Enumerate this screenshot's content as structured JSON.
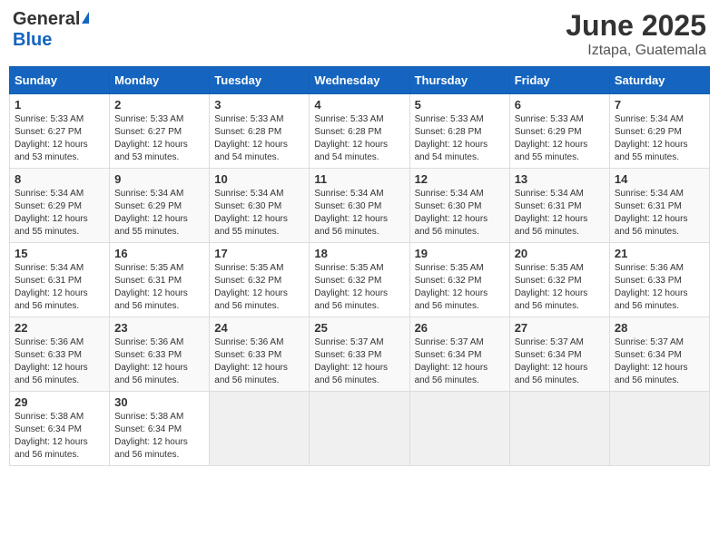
{
  "logo": {
    "general": "General",
    "blue": "Blue"
  },
  "header": {
    "month_year": "June 2025",
    "location": "Iztapa, Guatemala"
  },
  "weekdays": [
    "Sunday",
    "Monday",
    "Tuesday",
    "Wednesday",
    "Thursday",
    "Friday",
    "Saturday"
  ],
  "weeks": [
    [
      {
        "day": "1",
        "sunrise": "5:33 AM",
        "sunset": "6:27 PM",
        "daylight": "12 hours and 53 minutes."
      },
      {
        "day": "2",
        "sunrise": "5:33 AM",
        "sunset": "6:27 PM",
        "daylight": "12 hours and 53 minutes."
      },
      {
        "day": "3",
        "sunrise": "5:33 AM",
        "sunset": "6:28 PM",
        "daylight": "12 hours and 54 minutes."
      },
      {
        "day": "4",
        "sunrise": "5:33 AM",
        "sunset": "6:28 PM",
        "daylight": "12 hours and 54 minutes."
      },
      {
        "day": "5",
        "sunrise": "5:33 AM",
        "sunset": "6:28 PM",
        "daylight": "12 hours and 54 minutes."
      },
      {
        "day": "6",
        "sunrise": "5:33 AM",
        "sunset": "6:29 PM",
        "daylight": "12 hours and 55 minutes."
      },
      {
        "day": "7",
        "sunrise": "5:34 AM",
        "sunset": "6:29 PM",
        "daylight": "12 hours and 55 minutes."
      }
    ],
    [
      {
        "day": "8",
        "sunrise": "5:34 AM",
        "sunset": "6:29 PM",
        "daylight": "12 hours and 55 minutes."
      },
      {
        "day": "9",
        "sunrise": "5:34 AM",
        "sunset": "6:29 PM",
        "daylight": "12 hours and 55 minutes."
      },
      {
        "day": "10",
        "sunrise": "5:34 AM",
        "sunset": "6:30 PM",
        "daylight": "12 hours and 55 minutes."
      },
      {
        "day": "11",
        "sunrise": "5:34 AM",
        "sunset": "6:30 PM",
        "daylight": "12 hours and 56 minutes."
      },
      {
        "day": "12",
        "sunrise": "5:34 AM",
        "sunset": "6:30 PM",
        "daylight": "12 hours and 56 minutes."
      },
      {
        "day": "13",
        "sunrise": "5:34 AM",
        "sunset": "6:31 PM",
        "daylight": "12 hours and 56 minutes."
      },
      {
        "day": "14",
        "sunrise": "5:34 AM",
        "sunset": "6:31 PM",
        "daylight": "12 hours and 56 minutes."
      }
    ],
    [
      {
        "day": "15",
        "sunrise": "5:34 AM",
        "sunset": "6:31 PM",
        "daylight": "12 hours and 56 minutes."
      },
      {
        "day": "16",
        "sunrise": "5:35 AM",
        "sunset": "6:31 PM",
        "daylight": "12 hours and 56 minutes."
      },
      {
        "day": "17",
        "sunrise": "5:35 AM",
        "sunset": "6:32 PM",
        "daylight": "12 hours and 56 minutes."
      },
      {
        "day": "18",
        "sunrise": "5:35 AM",
        "sunset": "6:32 PM",
        "daylight": "12 hours and 56 minutes."
      },
      {
        "day": "19",
        "sunrise": "5:35 AM",
        "sunset": "6:32 PM",
        "daylight": "12 hours and 56 minutes."
      },
      {
        "day": "20",
        "sunrise": "5:35 AM",
        "sunset": "6:32 PM",
        "daylight": "12 hours and 56 minutes."
      },
      {
        "day": "21",
        "sunrise": "5:36 AM",
        "sunset": "6:33 PM",
        "daylight": "12 hours and 56 minutes."
      }
    ],
    [
      {
        "day": "22",
        "sunrise": "5:36 AM",
        "sunset": "6:33 PM",
        "daylight": "12 hours and 56 minutes."
      },
      {
        "day": "23",
        "sunrise": "5:36 AM",
        "sunset": "6:33 PM",
        "daylight": "12 hours and 56 minutes."
      },
      {
        "day": "24",
        "sunrise": "5:36 AM",
        "sunset": "6:33 PM",
        "daylight": "12 hours and 56 minutes."
      },
      {
        "day": "25",
        "sunrise": "5:37 AM",
        "sunset": "6:33 PM",
        "daylight": "12 hours and 56 minutes."
      },
      {
        "day": "26",
        "sunrise": "5:37 AM",
        "sunset": "6:34 PM",
        "daylight": "12 hours and 56 minutes."
      },
      {
        "day": "27",
        "sunrise": "5:37 AM",
        "sunset": "6:34 PM",
        "daylight": "12 hours and 56 minutes."
      },
      {
        "day": "28",
        "sunrise": "5:37 AM",
        "sunset": "6:34 PM",
        "daylight": "12 hours and 56 minutes."
      }
    ],
    [
      {
        "day": "29",
        "sunrise": "5:38 AM",
        "sunset": "6:34 PM",
        "daylight": "12 hours and 56 minutes."
      },
      {
        "day": "30",
        "sunrise": "5:38 AM",
        "sunset": "6:34 PM",
        "daylight": "12 hours and 56 minutes."
      },
      null,
      null,
      null,
      null,
      null
    ]
  ]
}
